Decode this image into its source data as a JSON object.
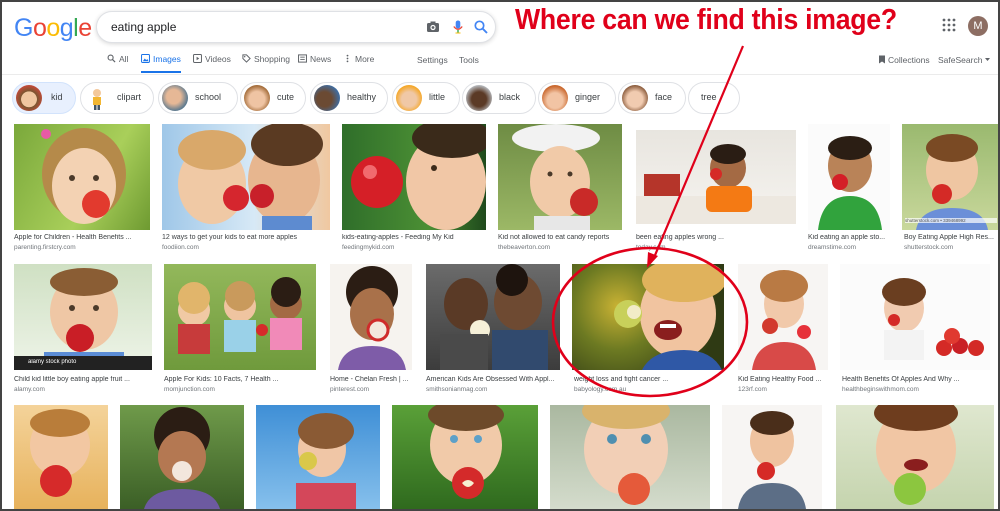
{
  "logo": "Google",
  "search": {
    "query": "eating apple"
  },
  "tabs": [
    {
      "label": "All"
    },
    {
      "label": "Images"
    },
    {
      "label": "Videos"
    },
    {
      "label": "Shopping"
    },
    {
      "label": "News"
    },
    {
      "label": "More"
    }
  ],
  "tools": {
    "settings": "Settings",
    "tools": "Tools",
    "collections": "Collections",
    "safesearch": "SafeSearch"
  },
  "account": {
    "initial": "M"
  },
  "chips": [
    "kid",
    "clipart",
    "school",
    "cute",
    "healthy",
    "little",
    "black",
    "ginger",
    "face",
    "tree"
  ],
  "annotation": "Where can we find this image?",
  "results": [
    {
      "title": "Apple for Children - Health Benefits ...",
      "source": "parenting.firstcry.com"
    },
    {
      "title": "12 ways to get your kids to eat more apples",
      "source": "foodiion.com"
    },
    {
      "title": "kids-eating-apples - Feeding My Kid",
      "source": "feedingmykid.com"
    },
    {
      "title": "Kid not allowed to eat candy reports",
      "source": "thebeaverton.com"
    },
    {
      "title": "been eating apples wrong ...",
      "source": "today.com"
    },
    {
      "title": "Kid eating an apple sto...",
      "source": "dreamstime.com"
    },
    {
      "title": "Boy Eating Apple High Res...",
      "source": "shutterstock.com"
    },
    {
      "title": "Child kid little boy eating apple fruit ...",
      "source": "alamy.com"
    },
    {
      "title": "Apple For Kids: 10 Facts, 7 Health ...",
      "source": "momjunction.com"
    },
    {
      "title": "Home - Chelan Fresh | ...",
      "source": "pinterest.com"
    },
    {
      "title": "American Kids Are Obsessed With Appl...",
      "source": "smithsonianmag.com"
    },
    {
      "title": "weight loss and fight cancer ...",
      "source": "babyology.com.au"
    },
    {
      "title": "Kid Eating Healthy Food ...",
      "source": "123rf.com"
    },
    {
      "title": "Health Benefits Of Apples And Why ...",
      "source": "healthbeginswithmom.com"
    }
  ],
  "watermarks": {
    "shutterstock": "shutterstock.com • 339468992",
    "alamy": "alamy stock photo"
  },
  "colors": {
    "accent": "#1a73e8",
    "annotation": "#e0001a"
  }
}
